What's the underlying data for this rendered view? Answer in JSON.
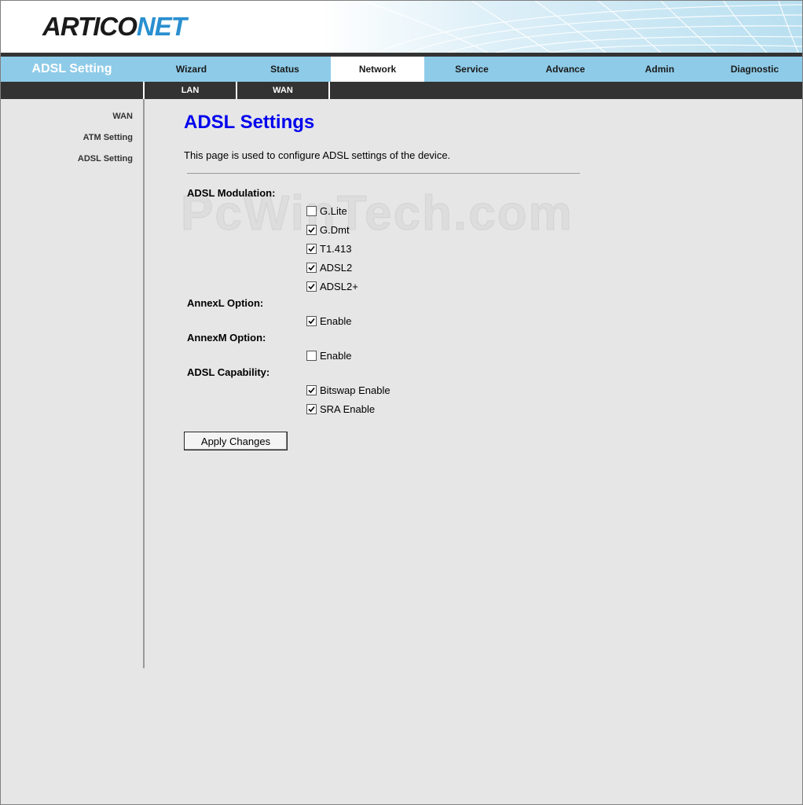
{
  "header": {
    "logo_part1": "ARTICO",
    "logo_part2": "NET"
  },
  "mainnav": {
    "brand": "ADSL Setting",
    "tabs": [
      {
        "label": "Wizard",
        "active": false
      },
      {
        "label": "Status",
        "active": false
      },
      {
        "label": "Network",
        "active": true
      },
      {
        "label": "Service",
        "active": false
      },
      {
        "label": "Advance",
        "active": false
      },
      {
        "label": "Admin",
        "active": false
      },
      {
        "label": "Diagnostic",
        "active": false
      }
    ]
  },
  "subnav": {
    "items": [
      {
        "label": "LAN"
      },
      {
        "label": "WAN"
      }
    ]
  },
  "sidebar": {
    "items": [
      {
        "label": "WAN"
      },
      {
        "label": "ATM Setting"
      },
      {
        "label": "ADSL Setting"
      }
    ]
  },
  "content": {
    "title": "ADSL Settings",
    "description": "This page is used to configure ADSL settings of the device.",
    "modulation": {
      "label": "ADSL Modulation:",
      "options": [
        {
          "label": "G.Lite",
          "checked": false
        },
        {
          "label": "G.Dmt",
          "checked": true
        },
        {
          "label": "T1.413",
          "checked": true
        },
        {
          "label": "ADSL2",
          "checked": true
        },
        {
          "label": "ADSL2+",
          "checked": true
        }
      ]
    },
    "annexl": {
      "label": "AnnexL Option:",
      "option": {
        "label": "Enable",
        "checked": true
      }
    },
    "annexm": {
      "label": "AnnexM Option:",
      "option": {
        "label": "Enable",
        "checked": false
      }
    },
    "capability": {
      "label": "ADSL Capability:",
      "options": [
        {
          "label": "Bitswap Enable",
          "checked": true
        },
        {
          "label": "SRA Enable",
          "checked": true
        }
      ]
    },
    "apply_label": "Apply Changes"
  },
  "watermark": "PcWinTech.com",
  "colors": {
    "nav_bar": "#8ecbe8",
    "subnav_bar": "#333333",
    "title": "#0000ee",
    "background": "#e6e6e6"
  }
}
